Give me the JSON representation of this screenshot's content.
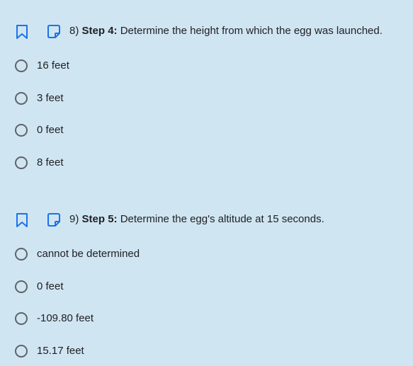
{
  "questions": [
    {
      "number": "8)",
      "step": "Step 4:",
      "text": "Determine the height from which the egg was launched.",
      "options": [
        "16 feet",
        "3 feet",
        "0 feet",
        "8 feet"
      ]
    },
    {
      "number": "9)",
      "step": "Step 5:",
      "text": "Determine the egg's altitude at 15 seconds.",
      "options": [
        "cannot be determined",
        "0 feet",
        "-109.80 feet",
        "15.17 feet"
      ]
    }
  ],
  "colors": {
    "background": "#d0e5f2",
    "icon_blue": "#1a73e8",
    "radio_border": "#5f6368",
    "text": "#202124"
  },
  "icons": {
    "bookmark": "bookmark-icon",
    "note": "note-icon"
  }
}
